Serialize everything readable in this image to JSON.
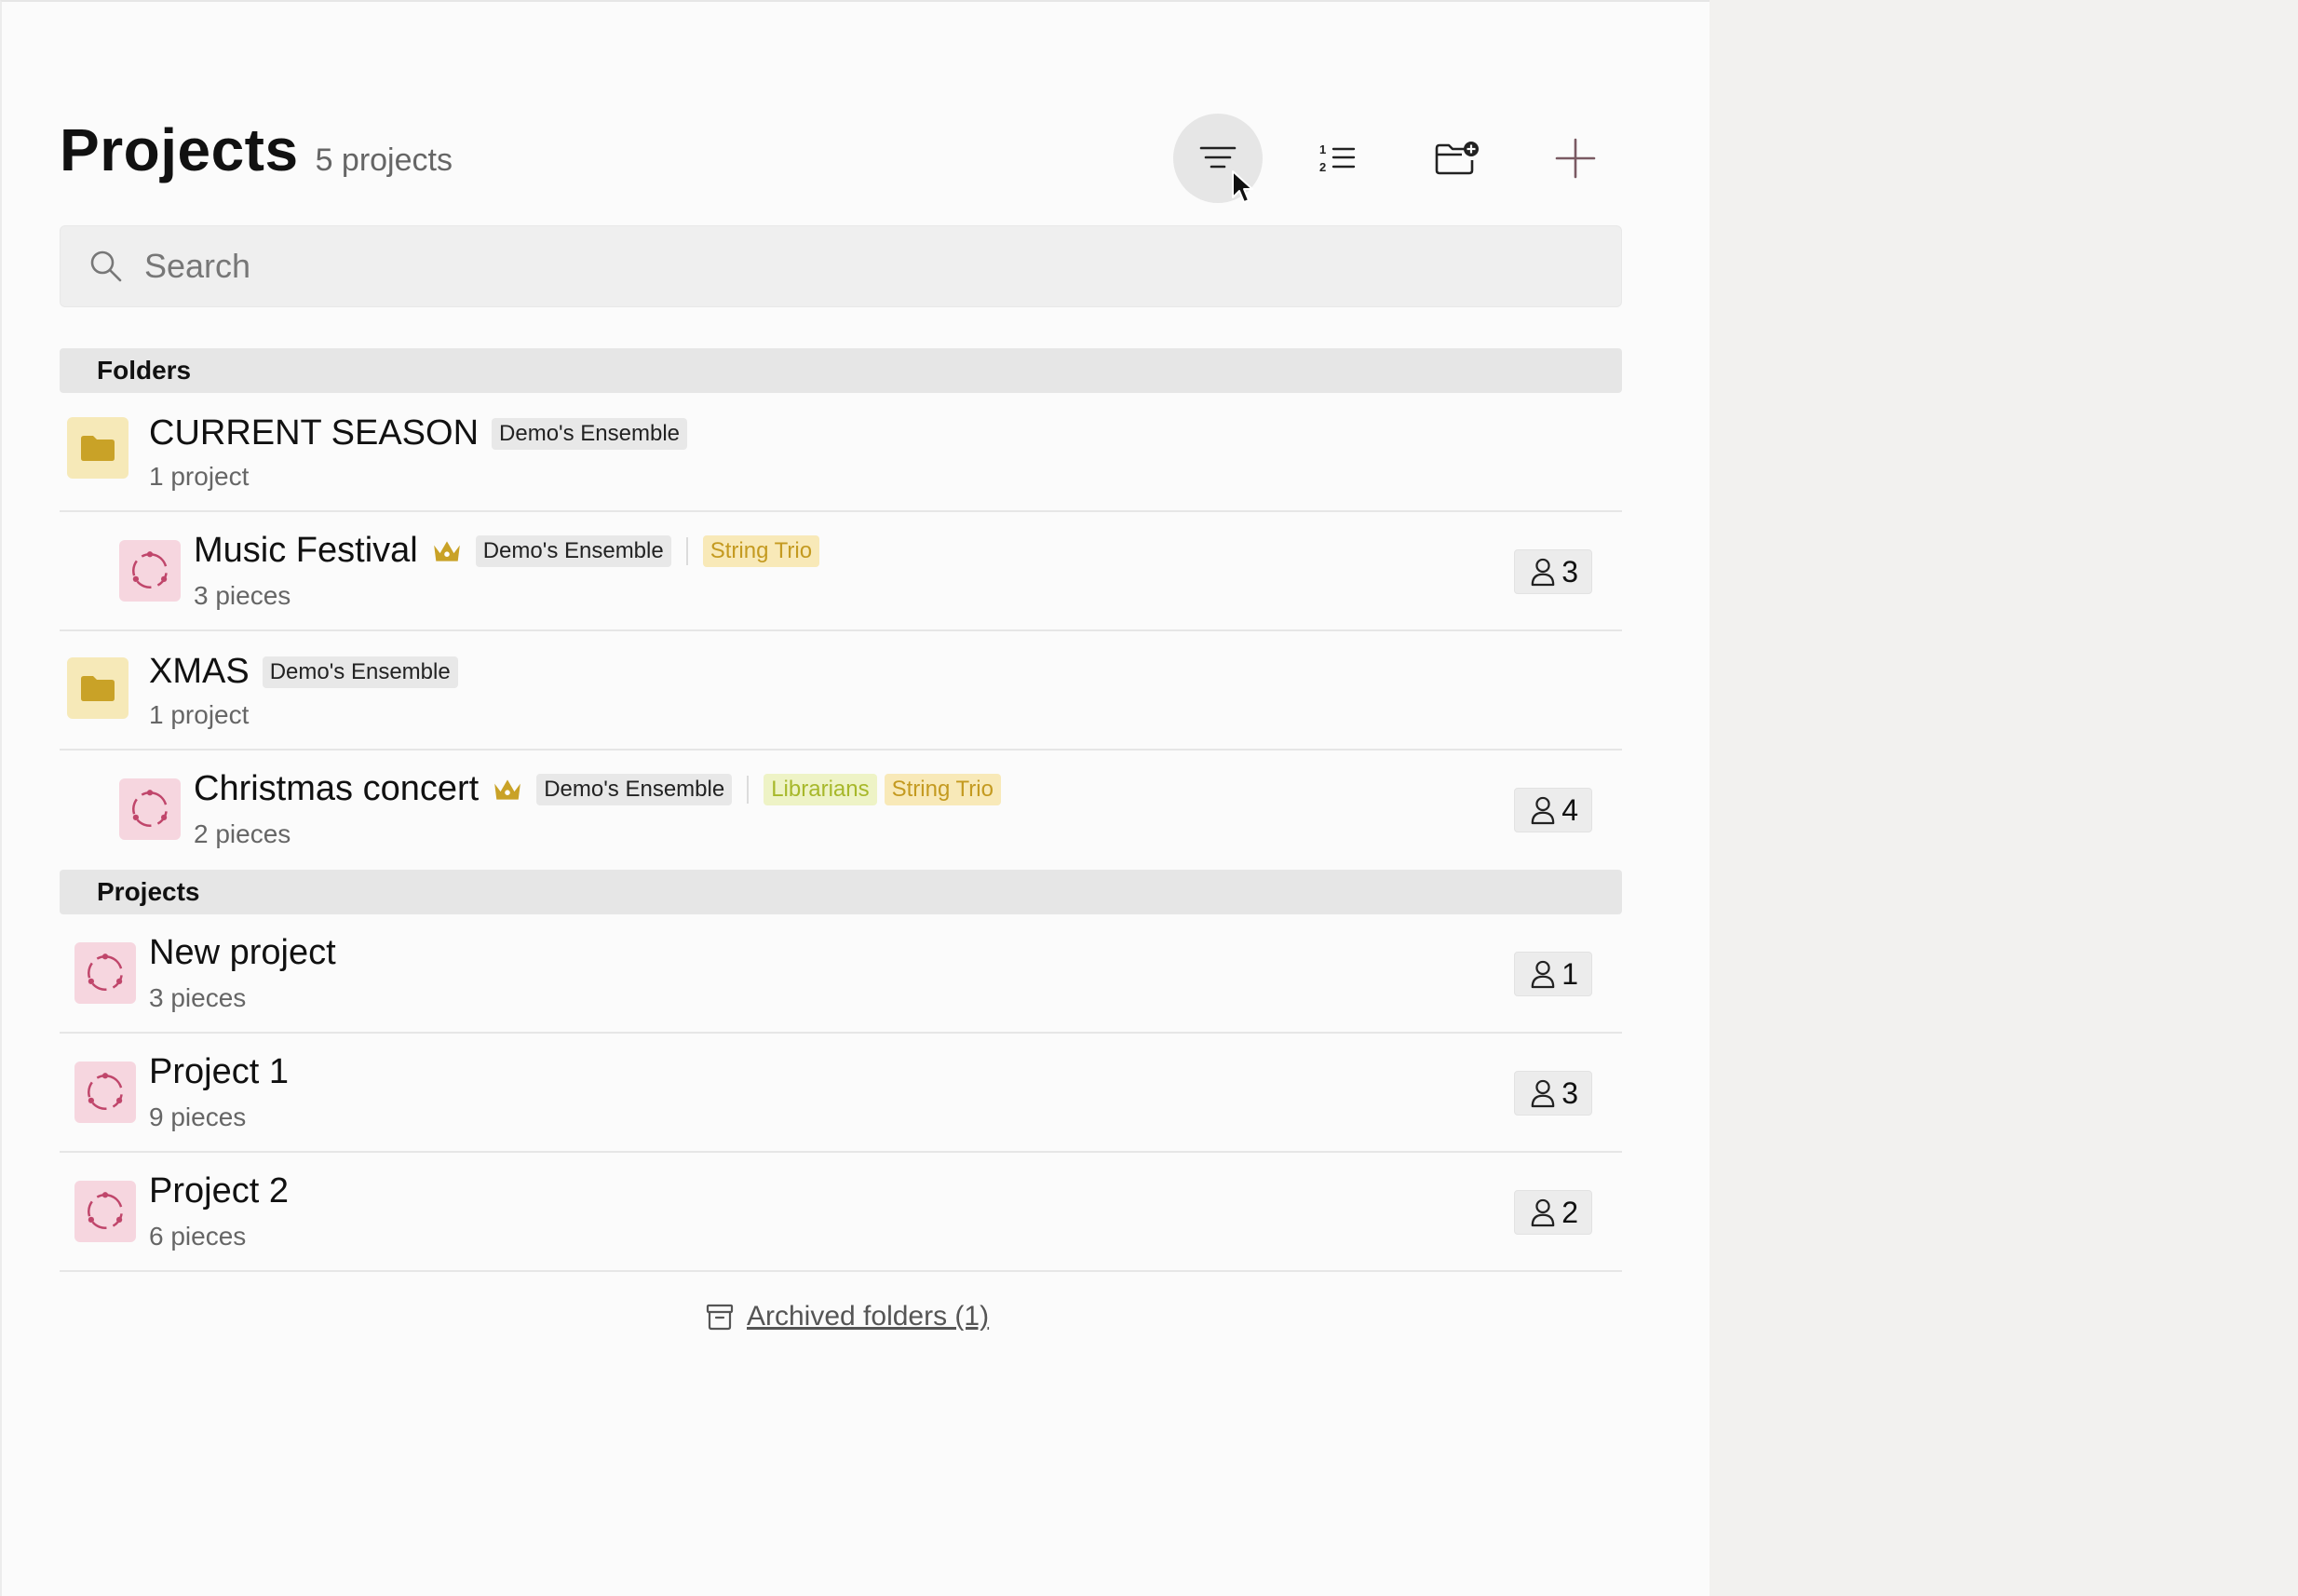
{
  "header": {
    "title": "Projects",
    "count": "5 projects"
  },
  "toolbar": {
    "items": [
      {
        "name": "filter",
        "icon": "filter-lines-icon",
        "active": true
      },
      {
        "name": "sort",
        "icon": "numbered-list-icon",
        "active": false
      },
      {
        "name": "new-folder",
        "icon": "folder-add-icon",
        "active": false
      },
      {
        "name": "add",
        "icon": "plus-icon",
        "active": false
      }
    ]
  },
  "search": {
    "placeholder": "Search",
    "value": ""
  },
  "sections": {
    "folders_label": "Folders",
    "projects_label": "Projects"
  },
  "folders": [
    {
      "name": "CURRENT SEASON",
      "ensemble": "Demo's Ensemble",
      "sub": "1 project",
      "children": [
        {
          "name": "Music Festival",
          "ensemble": "Demo's Ensemble",
          "groups": [
            "String Trio"
          ],
          "sub": "3 pieces",
          "members": "3"
        }
      ]
    },
    {
      "name": "XMAS",
      "ensemble": "Demo's Ensemble",
      "sub": "1 project",
      "children": [
        {
          "name": "Christmas concert",
          "ensemble": "Demo's Ensemble",
          "groups": [
            "Librarians",
            "String Trio"
          ],
          "sub": "2 pieces",
          "members": "4"
        }
      ]
    }
  ],
  "projects": [
    {
      "name": "New project",
      "sub": "3 pieces",
      "members": "1"
    },
    {
      "name": "Project 1",
      "sub": "9 pieces",
      "members": "3"
    },
    {
      "name": "Project 2",
      "sub": "6 pieces",
      "members": "2"
    }
  ],
  "footer": {
    "archived_label": "Archived folders (1)",
    "icon": "archive-box-icon"
  },
  "colors": {
    "folder_accent": "#c9a227",
    "project_accent": "#c0466b",
    "trio_tag": "#c49a20",
    "librarians_tag": "#a7b82a"
  }
}
